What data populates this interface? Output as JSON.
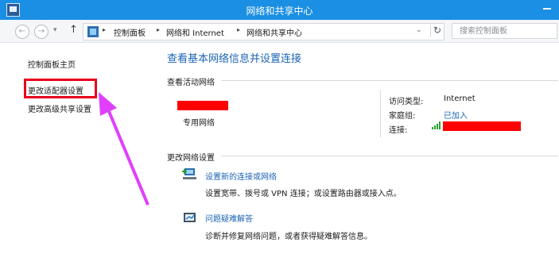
{
  "window": {
    "title": "网络和共享中心"
  },
  "nav": {
    "back": "←",
    "forward": "→",
    "recent": "▾",
    "up": "↑",
    "breadcrumb": [
      "控制面板",
      "网络和 Internet",
      "网络和共享中心"
    ],
    "separator": "▸",
    "address_dropdown": "⌄",
    "refresh": "↻",
    "search_placeholder": "搜索控制面板"
  },
  "sidebar": {
    "items": [
      {
        "label": "控制面板主页"
      },
      {
        "label": "更改适配器设置"
      },
      {
        "label": "更改高级共享设置"
      }
    ]
  },
  "main": {
    "heading": "查看基本网络信息并设置连接",
    "active_networks": {
      "title": "查看活动网络",
      "network_type": "专用网络",
      "access_type_label": "访问类型:",
      "access_type_value": "Internet",
      "homegroup_label": "家庭组:",
      "homegroup_value": "已加入",
      "connection_label": "连接:"
    },
    "change_settings": {
      "title": "更改网络设置",
      "tasks": [
        {
          "title": "设置新的连接或网络",
          "description": "设置宽带、拨号或 VPN 连接；或设置路由器或接入点。",
          "icon": "new-connection-icon"
        },
        {
          "title": "问题疑难解答",
          "description": "诊断并修复网络问题，或者获得疑难解答信息。",
          "icon": "troubleshoot-icon"
        }
      ]
    }
  },
  "annotation": {
    "color": "#e8001c",
    "arrow_color": "#e040fb"
  }
}
